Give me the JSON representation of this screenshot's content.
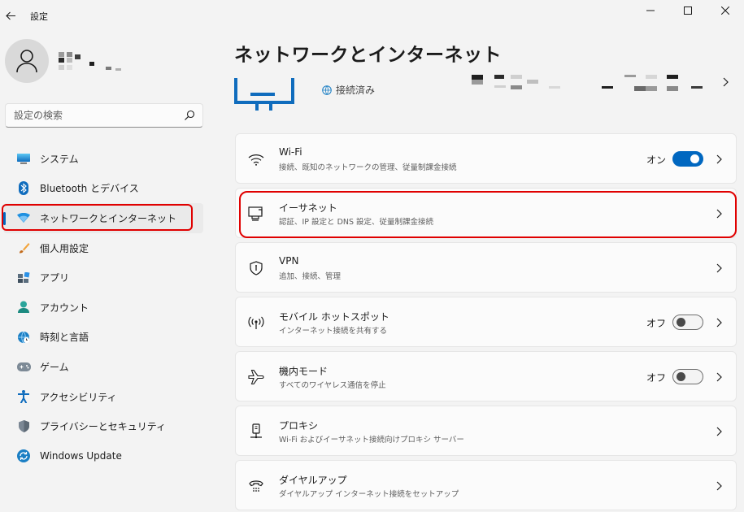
{
  "window": {
    "title": "設定",
    "controls": [
      "minimize-icon",
      "maximize-icon",
      "close-icon"
    ]
  },
  "search": {
    "placeholder": "設定の検索"
  },
  "sidebar": {
    "selected_index": 2,
    "items": [
      {
        "label": "システム",
        "icon": "system-icon"
      },
      {
        "label": "Bluetooth とデバイス",
        "icon": "bluetooth-icon"
      },
      {
        "label": "ネットワークとインターネット",
        "icon": "wifi-icon"
      },
      {
        "label": "個人用設定",
        "icon": "brush-icon"
      },
      {
        "label": "アプリ",
        "icon": "apps-icon"
      },
      {
        "label": "アカウント",
        "icon": "account-icon"
      },
      {
        "label": "時刻と言語",
        "icon": "time-language-icon"
      },
      {
        "label": "ゲーム",
        "icon": "gamepad-icon"
      },
      {
        "label": "アクセシビリティ",
        "icon": "accessibility-icon"
      },
      {
        "label": "プライバシーとセキュリティ",
        "icon": "shield-icon"
      },
      {
        "label": "Windows Update",
        "icon": "update-icon"
      }
    ]
  },
  "main": {
    "title": "ネットワークとインターネット",
    "status": "接続済み",
    "cards": [
      {
        "title": "Wi-Fi",
        "desc": "接続、既知のネットワークの管理、従量制課金接続",
        "icon": "wifi-icon",
        "toggle_label": "オン",
        "toggle_on": true
      },
      {
        "title": "イーサネット",
        "desc": "認証、IP 設定と DNS 設定、従量制課金接続",
        "icon": "ethernet-icon"
      },
      {
        "title": "VPN",
        "desc": "追加、接続、管理",
        "icon": "vpn-shield-icon"
      },
      {
        "title": "モバイル ホットスポット",
        "desc": "インターネット接続を共有する",
        "icon": "hotspot-icon",
        "toggle_label": "オフ",
        "toggle_on": false
      },
      {
        "title": "機内モード",
        "desc": "すべてのワイヤレス通信を停止",
        "icon": "airplane-icon",
        "toggle_label": "オフ",
        "toggle_on": false
      },
      {
        "title": "プロキシ",
        "desc": "Wi-Fi およびイーサネット接続向けプロキシ サーバー",
        "icon": "proxy-icon"
      },
      {
        "title": "ダイヤルアップ",
        "desc": "ダイヤルアップ インターネット接続をセットアップ",
        "icon": "dialup-icon"
      }
    ]
  },
  "colors": {
    "accent": "#0067c0",
    "highlight": "#e00000",
    "background": "#f3f3f3",
    "card": "#fbfbfb"
  }
}
